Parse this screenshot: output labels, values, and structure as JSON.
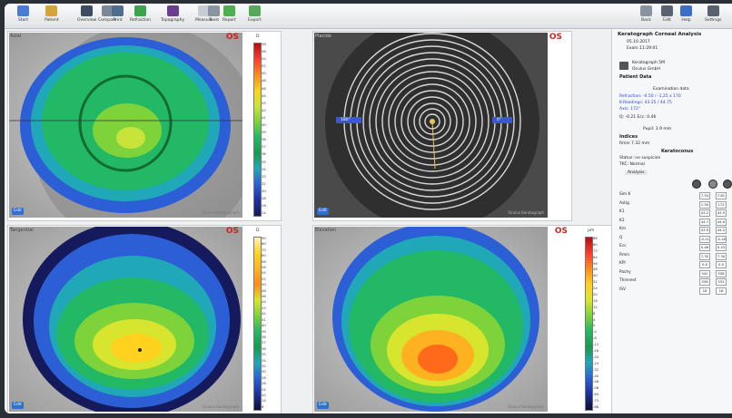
{
  "toolbar": {
    "buttons": [
      {
        "name": "home",
        "label": "Start",
        "color": "#4b7bd4"
      },
      {
        "name": "patient",
        "label": "Patient",
        "color": "#d4a53a"
      },
      {
        "name": "overview",
        "label": "Overview",
        "color": "#3d4b63"
      },
      {
        "name": "compare",
        "label": "Compare",
        "color": "#7c8896"
      },
      {
        "name": "print",
        "label": "Print",
        "color": "#4f6d8f"
      },
      {
        "name": "refraction",
        "label": "Refraction",
        "color": "#3fa34d"
      },
      {
        "name": "topo",
        "label": "Topography",
        "color": "#6b3d8c"
      },
      {
        "name": "measure",
        "label": "Measure",
        "color": "#c8cdd4"
      },
      {
        "name": "tools",
        "label": "Tools",
        "color": "#8a94a0"
      },
      {
        "name": "report",
        "label": "Report",
        "color": "#4caf50"
      },
      {
        "name": "export",
        "label": "Export",
        "color": "#57a85a"
      },
      {
        "name": "back",
        "label": "Back",
        "color": "#8a94a0"
      },
      {
        "name": "edit",
        "label": "Edit",
        "color": "#5a6270"
      },
      {
        "name": "help",
        "label": "Help",
        "color": "#3a6fc4"
      },
      {
        "name": "settings",
        "label": "Settings",
        "color": "#5a6270"
      }
    ]
  },
  "panes": {
    "eye": "OS",
    "axial_tag": "Axial",
    "rings_tag": "Placido",
    "tangential_tag": "Tangential",
    "elevation_tag": "Elevation",
    "ring_left": "180°",
    "ring_right": "0°",
    "button_label": "Edit",
    "footer": "Oculus Keratograph"
  },
  "scales": {
    "s1": {
      "unit": "D",
      "ticks": [
        "58",
        "56",
        "54",
        "52",
        "50",
        "48",
        "46",
        "44",
        "43",
        "42",
        "41",
        "40",
        "39",
        "38",
        "37",
        "36",
        "35",
        "34",
        "33",
        "32",
        "30",
        "28",
        "26",
        "24"
      ]
    },
    "s2": {
      "unit": "D",
      "ticks": [
        "90",
        "80",
        "70",
        "60",
        "58",
        "56",
        "54",
        "52",
        "50",
        "48",
        "46",
        "44",
        "43",
        "42",
        "41",
        "40",
        "39",
        "38",
        "37",
        "36",
        "35",
        "34",
        "32",
        "30",
        "28",
        "26",
        "24",
        "20",
        "14",
        "8"
      ]
    },
    "s3": {
      "unit": "µm",
      "ticks": [
        "88",
        "80",
        "72",
        "64",
        "56",
        "48",
        "40",
        "32",
        "24",
        "20",
        "16",
        "12",
        "8",
        "4",
        "0",
        "-4",
        "-8",
        "-12",
        "-16",
        "-20",
        "-24",
        "-32",
        "-40",
        "-48",
        "-56",
        "-64",
        "-72",
        "-88"
      ]
    }
  },
  "right_panel": {
    "title": "Keratograph Corneal Analysis",
    "date": "05.10.2017",
    "exam_time": "Exam 11:29:01",
    "device": "Keratograph 5M",
    "device_sub": "Oculus GmbH",
    "section1": "Patient Data",
    "section1b": "Examination data",
    "link1": "Refraction: -0.50 / -1.25 x 170",
    "link2": "K-Readings: 43.25 / 44.75",
    "link3": "Axis: 172°",
    "line4": "Q: -0.21   Ecc: 0.46",
    "line5": "Pupil: 3.9 mm",
    "section2": "Indices",
    "line6": "Rmin 7.32 mm",
    "section3": "Keratoconus",
    "line7": "Status: no suspicion",
    "line8": "TKC: Normal",
    "line9": "Analysis",
    "grid": [
      {
        "label": "Sim K",
        "v1": "7.54",
        "v2": "7.81"
      },
      {
        "label": "Astig.",
        "v1": "1.50",
        "v2": "172"
      },
      {
        "label": "K1",
        "v1": "43.2",
        "v2": "43.5"
      },
      {
        "label": "K2",
        "v1": "44.7",
        "v2": "44.9"
      },
      {
        "label": "Km",
        "v1": "43.9",
        "v2": "44.2"
      },
      {
        "label": "Q",
        "v1": "-0.21",
        "v2": "-0.18"
      },
      {
        "label": "Ecc",
        "v1": "0.46",
        "v2": "0.43"
      },
      {
        "label": "Rmin",
        "v1": "7.32",
        "v2": "7.30"
      },
      {
        "label": "KPI",
        "v1": "0.0",
        "v2": "0.0"
      },
      {
        "label": "Pachy",
        "v1": "541",
        "v2": "538"
      },
      {
        "label": "Thinnest",
        "v1": "536",
        "v2": "532"
      },
      {
        "label": "ISV",
        "v1": "18",
        "v2": "16"
      }
    ]
  }
}
